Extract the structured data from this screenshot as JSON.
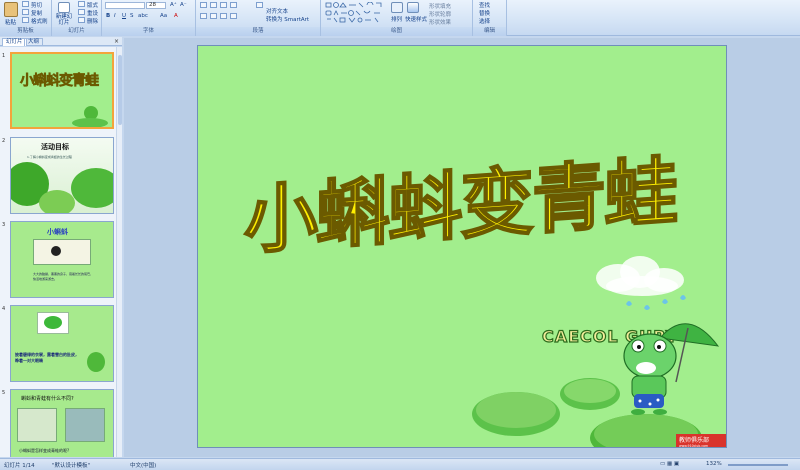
{
  "ribbon": {
    "groups": [
      {
        "label": "剪贴板",
        "items": [
          "粘贴",
          "剪切",
          "复制",
          "格式刷"
        ]
      },
      {
        "label": "幻灯片",
        "items": [
          "新建幻灯片",
          "版式",
          "重设",
          "删除"
        ]
      },
      {
        "label": "字体",
        "items": [
          "28",
          "B",
          "I",
          "U",
          "S",
          "abc",
          "Aa",
          "A"
        ]
      },
      {
        "label": "段落",
        "items": [
          "对齐文本",
          "转换为 SmartArt"
        ]
      },
      {
        "label": "绘图",
        "items": [
          "排列",
          "快速样式",
          "形状填充",
          "形状轮廓",
          "形状效果"
        ]
      },
      {
        "label": "编辑",
        "items": [
          "查找",
          "替换",
          "选择"
        ]
      }
    ]
  },
  "panel": {
    "tabs": [
      "幻灯片",
      "大纲"
    ],
    "close": "×",
    "slides": [
      {
        "num": "1",
        "title": "小蝌蚪变青蛙",
        "caption": ""
      },
      {
        "num": "2",
        "title": "活动目标",
        "caption": "1.了解小蝌蚪变成青蛙的生长过程"
      },
      {
        "num": "3",
        "title": "小蝌蚪",
        "caption": "大大的脑袋，黑黑的身子，甩着长长的尾巴，快活地游来游去。"
      },
      {
        "num": "4",
        "title": "",
        "caption": "披着碧绿的衣裳，露着雪白的肚皮，睁着一对大眼睛"
      },
      {
        "num": "5",
        "title": "蝌蚪和青蛙有什么不同?",
        "caption": "小蝌蚪是怎样变成青蛙的呢?"
      }
    ]
  },
  "slide": {
    "title": "小蝌蚪变青蛙",
    "logo_text": "CAECOL GURY",
    "stamp": "教师俱乐部",
    "url": "www.910club.com"
  },
  "status": {
    "slide_pos": "幻灯片 1/14",
    "theme": "\"默认设计模板\"",
    "lang": "中文(中国)",
    "zoom": "132%"
  },
  "colors": {
    "slide_bg": "#a2ee8d",
    "title_fill": "#ffef00",
    "title_stroke": "#6b5a00",
    "selected_border": "#f3a43b"
  }
}
